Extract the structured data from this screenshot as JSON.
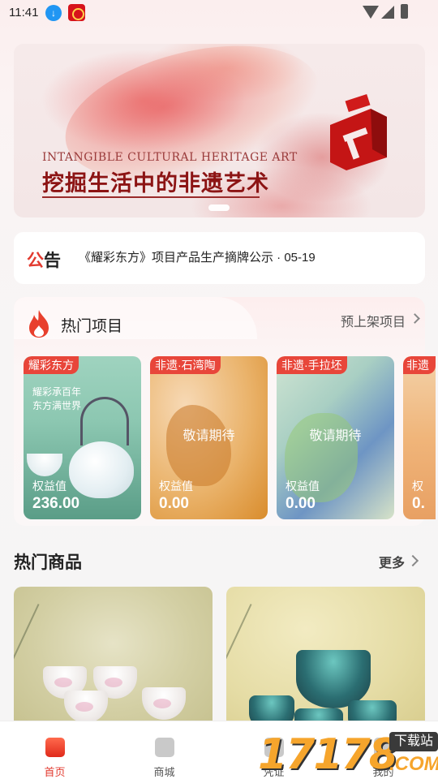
{
  "status_bar": {
    "time": "11:41"
  },
  "banner": {
    "en_text": "INTANGIBLE CULTURAL HERITAGE ART",
    "cn_text": "挖掘生活中的非遗艺术"
  },
  "notice": {
    "label_part1": "公",
    "label_part2": "告",
    "text": "《耀彩东方》项目产品生产摘牌公示  ·   05-19"
  },
  "hot_projects": {
    "title": "热门项目",
    "presale_link": "预上架项目",
    "cards": [
      {
        "tag": "耀彩东方",
        "slogan_line1": "耀彩承百年",
        "slogan_line2": "东方满世界",
        "value_label": "权益值",
        "value": "236.00"
      },
      {
        "tag": "非遗·石湾陶",
        "wait_text": "敬请期待",
        "value_label": "权益值",
        "value": "0.00"
      },
      {
        "tag": "非遗·手拉坯",
        "wait_text": "敬请期待",
        "value_label": "权益值",
        "value": "0.00"
      },
      {
        "tag": "非遗",
        "value_label": "权",
        "value": "0."
      }
    ]
  },
  "hot_goods": {
    "title": "热门商品",
    "more_link": "更多"
  },
  "tab_bar": {
    "tabs": [
      {
        "label": "首页",
        "active": true,
        "icon": "home-icon"
      },
      {
        "label": "商城",
        "active": false,
        "icon": "shopping-bag-icon"
      },
      {
        "label": "凭证",
        "active": false,
        "icon": "voucher-icon"
      },
      {
        "label": "我的",
        "active": false,
        "icon": "profile-icon"
      }
    ]
  },
  "watermark": {
    "number": "17178",
    "badge": "下载站",
    "suffix": ".COM"
  },
  "colors": {
    "accent": "#e23a2f",
    "tag_bg": "#e8463a"
  }
}
